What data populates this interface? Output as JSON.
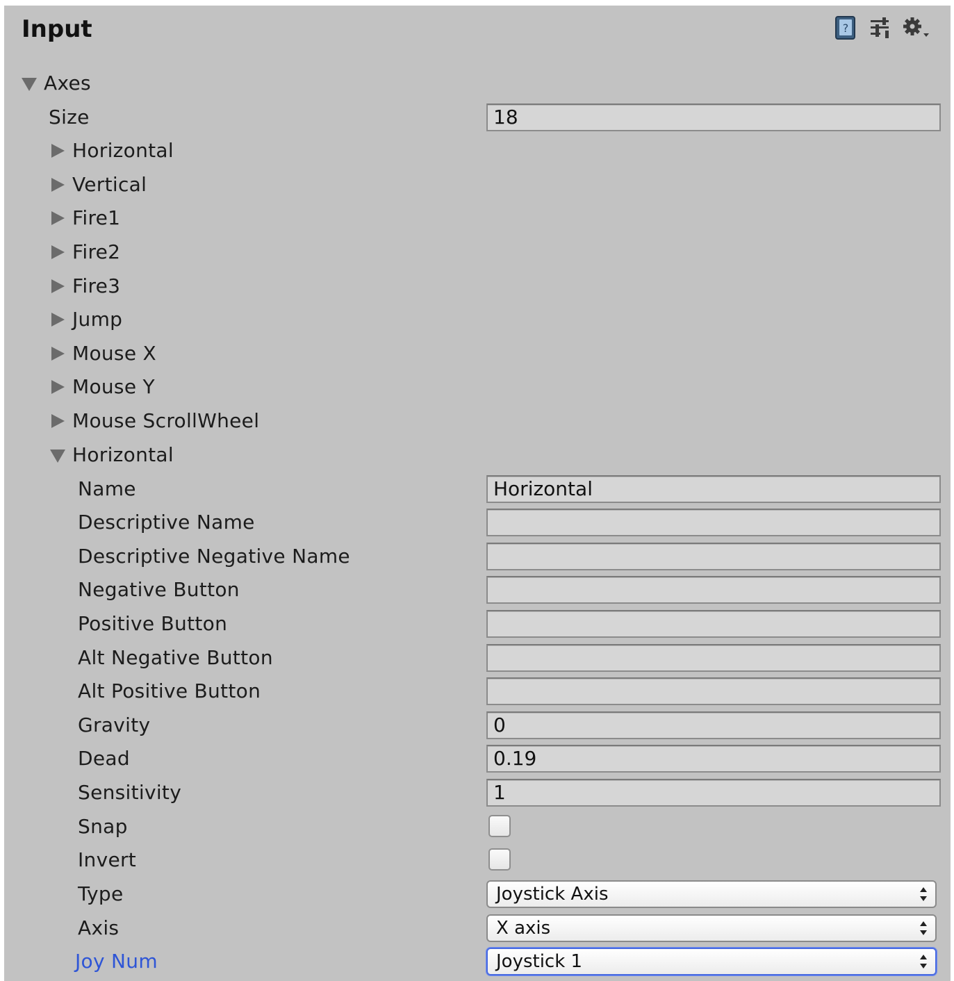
{
  "header": {
    "title": "Input",
    "icons": [
      "help-book-icon",
      "preset-sliders-icon",
      "settings-gear-icon"
    ]
  },
  "axes": {
    "label": "Axes",
    "size_label": "Size",
    "size_value": "18",
    "items": [
      "Horizontal",
      "Vertical",
      "Fire1",
      "Fire2",
      "Fire3",
      "Jump",
      "Mouse X",
      "Mouse Y",
      "Mouse ScrollWheel"
    ],
    "expanded": {
      "label": "Horizontal",
      "name_label": "Name",
      "name_value": "Horizontal",
      "descriptive_name_label": "Descriptive Name",
      "descriptive_name_value": "",
      "descriptive_negative_name_label": "Descriptive Negative Name",
      "descriptive_negative_name_value": "",
      "negative_button_label": "Negative Button",
      "negative_button_value": "",
      "positive_button_label": "Positive Button",
      "positive_button_value": "",
      "alt_negative_button_label": "Alt Negative Button",
      "alt_negative_button_value": "",
      "alt_positive_button_label": "Alt Positive Button",
      "alt_positive_button_value": "",
      "gravity_label": "Gravity",
      "gravity_value": "0",
      "dead_label": "Dead",
      "dead_value": "0.19",
      "sensitivity_label": "Sensitivity",
      "sensitivity_value": "1",
      "snap_label": "Snap",
      "snap_checked": false,
      "invert_label": "Invert",
      "invert_checked": false,
      "type_label": "Type",
      "type_value": "Joystick Axis",
      "axis_label": "Axis",
      "axis_value": "X axis",
      "joy_num_label": "Joy Num",
      "joy_num_value": "Joystick 1"
    }
  },
  "colors": {
    "panel_bg": "#c2c2c2",
    "field_bg": "#d6d6d6",
    "focus_label": "#2e55d6",
    "focus_border": "#4a6be0"
  }
}
